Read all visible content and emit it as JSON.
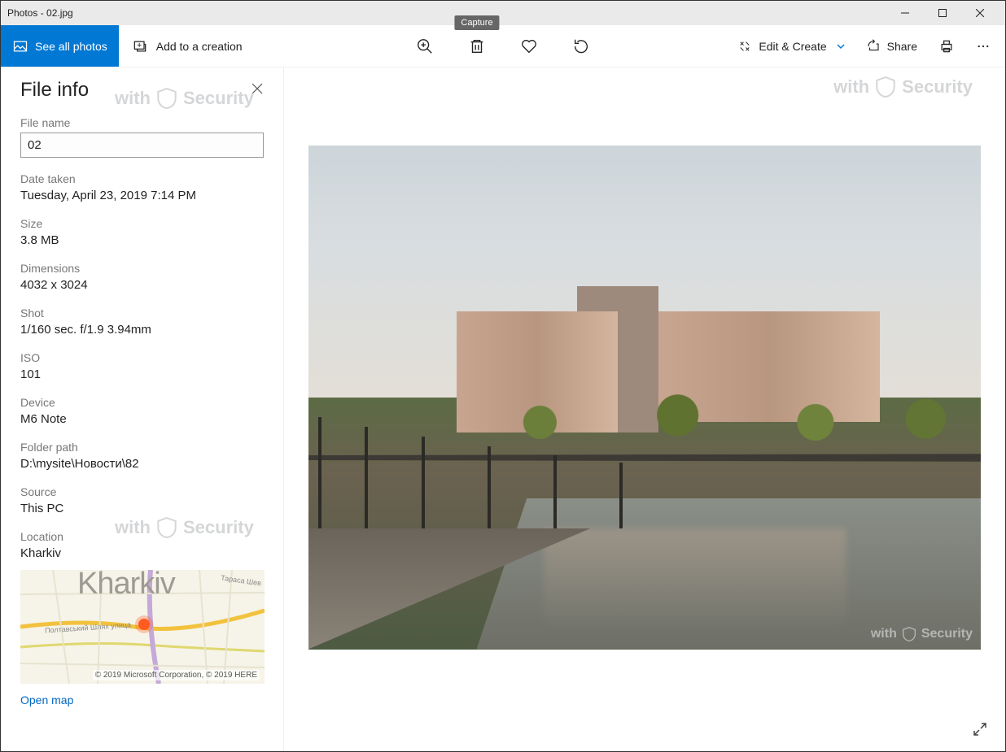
{
  "titlebar": {
    "title": "Photos - 02.jpg"
  },
  "toolbar": {
    "see_all": "See all photos",
    "add_creation": "Add to a creation",
    "tooltip_capture": "Capture",
    "edit_create": "Edit & Create",
    "share": "Share"
  },
  "sidebar": {
    "title": "File info",
    "fields": {
      "file_name_label": "File name",
      "file_name_value": "02",
      "date_label": "Date taken",
      "date_value": "Tuesday, April 23, 2019 7:14 PM",
      "size_label": "Size",
      "size_value": "3.8 MB",
      "dimensions_label": "Dimensions",
      "dimensions_value": "4032 x 3024",
      "shot_label": "Shot",
      "shot_value": "1/160 sec. f/1.9 3.94mm",
      "iso_label": "ISO",
      "iso_value": "101",
      "device_label": "Device",
      "device_value": "M6 Note",
      "folder_label": "Folder path",
      "folder_value": "D:\\mysite\\Новости\\82",
      "source_label": "Source",
      "source_value": "This PC",
      "location_label": "Location",
      "location_value": "Kharkiv"
    },
    "map": {
      "city": "Kharkiv",
      "street1": "Полтавський Шлях улица",
      "street2": "Тараса Шев",
      "credit": "© 2019 Microsoft Corporation, © 2019 HERE"
    },
    "open_map": "Open map"
  },
  "watermark": {
    "brand_prefix": "with",
    "brand_suffix": "Security"
  }
}
